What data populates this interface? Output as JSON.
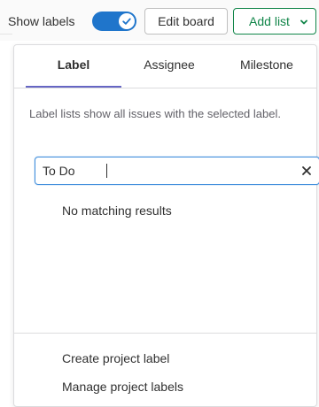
{
  "toolbar": {
    "show_labels": "Show labels",
    "show_labels_enabled": true,
    "edit_board": "Edit board",
    "add_list": "Add list"
  },
  "dropdown": {
    "tabs": [
      {
        "label": "Label",
        "active": true
      },
      {
        "label": "Assignee",
        "active": false
      },
      {
        "label": "Milestone",
        "active": false
      }
    ],
    "description": "Label lists show all issues with the selected label.",
    "search": {
      "value": "To Do"
    },
    "no_results": "No matching results",
    "footer": {
      "create": "Create project label",
      "manage": "Manage project labels"
    }
  },
  "colors": {
    "toggle_on": "#1f75cb",
    "add_list_green": "#108548",
    "active_tab_underline": "#6666c4",
    "search_focus": "#428fdc"
  },
  "icons": {
    "toggle": "checkmark-icon",
    "add_list": "chevron-down-icon",
    "clear": "close-icon"
  }
}
